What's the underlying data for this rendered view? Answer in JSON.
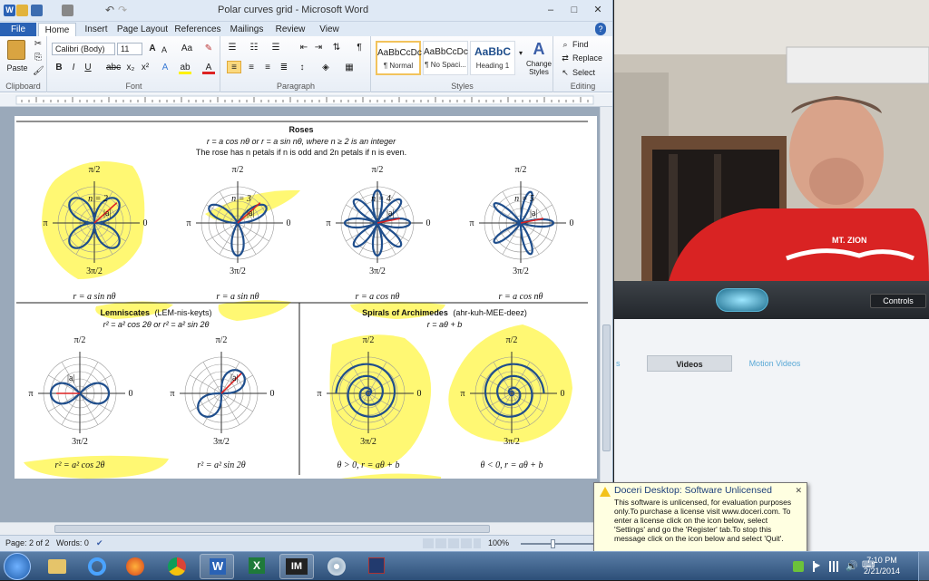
{
  "word": {
    "window_title": "Polar curves grid - Microsoft Word",
    "tabs": [
      "File",
      "Home",
      "Insert",
      "Page Layout",
      "References",
      "Mailings",
      "Review",
      "View"
    ],
    "active_tab": "Home",
    "clipboard": {
      "paste": "Paste",
      "label": "Clipboard"
    },
    "font": {
      "name": "Calibri (Body)",
      "size": "11",
      "label": "Font"
    },
    "paragraph": {
      "label": "Paragraph"
    },
    "styles": {
      "label": "Styles",
      "items": [
        {
          "sample": "AaBbCcDc",
          "name": "¶ Normal"
        },
        {
          "sample": "AaBbCcDc",
          "name": "¶ No Spaci..."
        },
        {
          "sample": "AaBbC",
          "name": "Heading 1"
        }
      ],
      "change_styles": "Change Styles"
    },
    "editing": {
      "find": "Find",
      "replace": "Replace",
      "select": "Select",
      "label": "Editing"
    },
    "status": {
      "page": "Page: 2 of 2",
      "words": "Words: 0",
      "zoom": "100%"
    }
  },
  "doc": {
    "roses": {
      "title": "Roses",
      "eq": "r = a cos nθ or r = a sin nθ, where n ≥ 2 is an integer",
      "desc": "The rose has n petals if n is odd and 2n petals if n is even.",
      "graphs": [
        {
          "n": "n = 2",
          "caption": "r = a sin nθ"
        },
        {
          "n": "n = 3",
          "caption": "r = a sin nθ"
        },
        {
          "n": "n = 4",
          "caption": "r = a cos nθ"
        },
        {
          "n": "n = 5",
          "caption": "r = a cos nθ"
        }
      ]
    },
    "lemniscates": {
      "title": "Lemniscates",
      "pron": "(LEM-nis-keyts)",
      "eq": "r² = a² cos 2θ or r² = a² sin 2θ",
      "captions": [
        "r² = a² cos 2θ",
        "r² = a² sin 2θ"
      ]
    },
    "spirals": {
      "title": "Spirals of Archimedes",
      "pron": "(ahr-kuh-MEE-deez)",
      "eq": "r = aθ + b",
      "captions": [
        "θ > 0, r = aθ + b",
        "θ < 0, r = aθ + b"
      ]
    },
    "axis": {
      "top": "π/2",
      "left": "π",
      "right": "0",
      "bottom": "3π/2",
      "a": "|a|"
    }
  },
  "doceri": {
    "controls": "Controls",
    "subtabs": [
      "s",
      "Videos",
      "Motion Videos"
    ],
    "active_subtab": "Videos",
    "shirt_text": "MT. ZION"
  },
  "notification": {
    "title": "Doceri Desktop: Software Unlicensed",
    "body": "This software is unlicensed, for evaluation purposes only.To purchase a license visit www.doceri.com. To enter a license click on the icon below, select 'Settings' and go the 'Register' tab.To stop this message click on the icon below and select 'Quit'."
  },
  "taskbar": {
    "time": "7:10 PM",
    "date": "2/21/2014",
    "im_label": "IM"
  },
  "colors": {
    "highlight": "#fff200",
    "curve": "#1f4e8c",
    "accent": "#d22"
  }
}
